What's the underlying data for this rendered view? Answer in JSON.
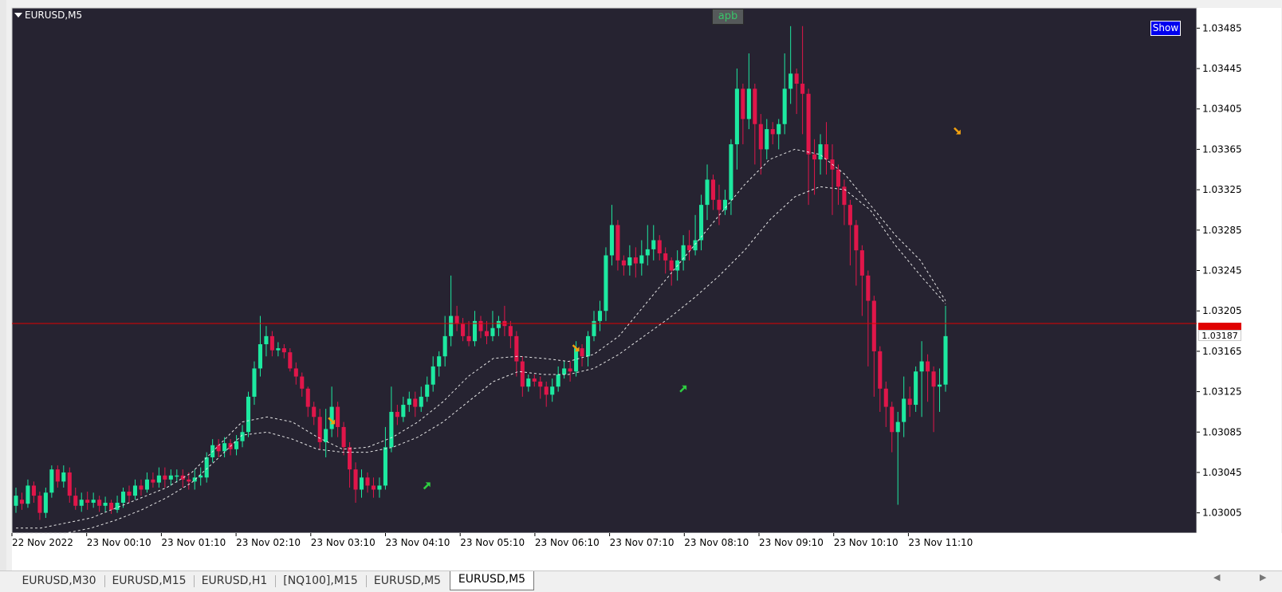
{
  "chart_label": "EURUSD,M5",
  "indicator_badge": "apb",
  "show_button": "Show",
  "current_price": "1.03187",
  "colors": {
    "background": "#262331",
    "bull": "#1de9a0",
    "bear": "#e0164a",
    "price_line": "#e00000",
    "envelope": "#e6e6e6",
    "sell_arrow": "#f0a010",
    "buy_arrow": "#2ecc40"
  },
  "tabs": [
    {
      "label": "EURUSD,M30",
      "active": false
    },
    {
      "label": "EURUSD,M15",
      "active": false
    },
    {
      "label": "EURUSD,H1",
      "active": false
    },
    {
      "label": "[NQ100],M15",
      "active": false
    },
    {
      "label": "EURUSD,M5",
      "active": false
    },
    {
      "label": "EURUSD,M5",
      "active": true
    }
  ],
  "chart_data": {
    "type": "candlestick",
    "symbol": "EURUSD",
    "timeframe": "M5",
    "ylim": [
      1.02985,
      1.03505
    ],
    "y_ticks": [
      "1.03485",
      "1.03445",
      "1.03405",
      "1.03365",
      "1.03325",
      "1.03285",
      "1.03245",
      "1.03205",
      "1.03165",
      "1.03125",
      "1.03085",
      "1.03045",
      "1.03005"
    ],
    "x_ticks": [
      "22 Nov 2022",
      "23 Nov 00:10",
      "23 Nov 01:10",
      "23 Nov 02:10",
      "23 Nov 03:10",
      "23 Nov 04:10",
      "23 Nov 05:10",
      "23 Nov 06:10",
      "23 Nov 07:10",
      "23 Nov 08:10",
      "23 Nov 09:10",
      "23 Nov 10:10",
      "23 Nov 11:10"
    ],
    "current_price": 1.03187,
    "candles": [
      [
        1.03012,
        1.03022,
        1.0303,
        1.03005
      ],
      [
        1.03018,
        1.03014,
        1.03025,
        1.03008
      ],
      [
        1.03014,
        1.03032,
        1.03038,
        1.0301
      ],
      [
        1.03032,
        1.03022,
        1.03036,
        1.03015
      ],
      [
        1.03022,
        1.03005,
        1.03026,
        1.02998
      ],
      [
        1.03005,
        1.03025,
        1.0303,
        1.03
      ],
      [
        1.03025,
        1.03048,
        1.03052,
        1.0302
      ],
      [
        1.03048,
        1.03036,
        1.03052,
        1.0303
      ],
      [
        1.03036,
        1.03045,
        1.03052,
        1.0303
      ],
      [
        1.03045,
        1.03022,
        1.0305,
        1.03015
      ],
      [
        1.03022,
        1.03012,
        1.0303,
        1.03008
      ],
      [
        1.03012,
        1.03018,
        1.03025,
        1.03006
      ],
      [
        1.03018,
        1.03015,
        1.03026,
        1.03008
      ],
      [
        1.03015,
        1.03018,
        1.03025,
        1.0301
      ],
      [
        1.03018,
        1.03012,
        1.03022,
        1.03006
      ],
      [
        1.03012,
        1.03015,
        1.03021,
        1.03006
      ],
      [
        1.03015,
        1.03008,
        1.03018,
        1.03004
      ],
      [
        1.03008,
        1.03015,
        1.03022,
        1.03005
      ],
      [
        1.03015,
        1.03026,
        1.0303,
        1.0301
      ],
      [
        1.03026,
        1.03022,
        1.03032,
        1.03015
      ],
      [
        1.03022,
        1.03032,
        1.03038,
        1.03018
      ],
      [
        1.03032,
        1.03028,
        1.03038,
        1.03022
      ],
      [
        1.03028,
        1.03038,
        1.03045,
        1.03025
      ],
      [
        1.03038,
        1.03035,
        1.03045,
        1.0303
      ],
      [
        1.03035,
        1.03042,
        1.0305,
        1.0303
      ],
      [
        1.03042,
        1.03038,
        1.0305,
        1.0303
      ],
      [
        1.03038,
        1.03042,
        1.03048,
        1.03032
      ],
      [
        1.03042,
        1.03042,
        1.03048,
        1.03035
      ],
      [
        1.03042,
        1.03038,
        1.03048,
        1.0303
      ],
      [
        1.03038,
        1.03036,
        1.03045,
        1.03028
      ],
      [
        1.03036,
        1.0304,
        1.03048,
        1.03028
      ],
      [
        1.0304,
        1.03042,
        1.0305,
        1.03032
      ],
      [
        1.0304,
        1.0306,
        1.03065,
        1.03035
      ],
      [
        1.0306,
        1.03072,
        1.03078,
        1.03055
      ],
      [
        1.03072,
        1.03066,
        1.03078,
        1.0306
      ],
      [
        1.03066,
        1.03074,
        1.0308,
        1.0306
      ],
      [
        1.03074,
        1.03068,
        1.03078,
        1.03062
      ],
      [
        1.03068,
        1.03076,
        1.03082,
        1.03062
      ],
      [
        1.03076,
        1.03085,
        1.03092,
        1.0307
      ],
      [
        1.03085,
        1.0312,
        1.03125,
        1.0308
      ],
      [
        1.0312,
        1.03148,
        1.03155,
        1.03112
      ],
      [
        1.03148,
        1.03172,
        1.032,
        1.0314
      ],
      [
        1.03172,
        1.0318,
        1.0319,
        1.0316
      ],
      [
        1.0318,
        1.03166,
        1.03185,
        1.0316
      ],
      [
        1.03166,
        1.03168,
        1.03174,
        1.0316
      ],
      [
        1.03168,
        1.03164,
        1.03172,
        1.03158
      ],
      [
        1.03164,
        1.03148,
        1.03168,
        1.03145
      ],
      [
        1.03148,
        1.0314,
        1.03154,
        1.03132
      ],
      [
        1.0314,
        1.03128,
        1.03144,
        1.0312
      ],
      [
        1.03128,
        1.0311,
        1.0313,
        1.031
      ],
      [
        1.0311,
        1.031,
        1.03115,
        1.03092
      ],
      [
        1.031,
        1.03075,
        1.03108,
        1.03068
      ],
      [
        1.03075,
        1.03088,
        1.03108,
        1.0306
      ],
      [
        1.03088,
        1.0311,
        1.0313,
        1.0308
      ],
      [
        1.0311,
        1.0309,
        1.03115,
        1.0308
      ],
      [
        1.0309,
        1.0307,
        1.03095,
        1.03062
      ],
      [
        1.0307,
        1.03048,
        1.03075,
        1.0303
      ],
      [
        1.03048,
        1.03028,
        1.03055,
        1.03015
      ],
      [
        1.03028,
        1.0304,
        1.03048,
        1.0302
      ],
      [
        1.0304,
        1.03032,
        1.03045,
        1.03025
      ],
      [
        1.03032,
        1.03028,
        1.0304,
        1.0302
      ],
      [
        1.03028,
        1.03032,
        1.0304,
        1.0302
      ],
      [
        1.03032,
        1.0307,
        1.0309,
        1.03028
      ],
      [
        1.0307,
        1.03105,
        1.0313,
        1.03065
      ],
      [
        1.03105,
        1.031,
        1.03112,
        1.03092
      ],
      [
        1.031,
        1.03112,
        1.0312,
        1.03095
      ],
      [
        1.03112,
        1.03118,
        1.03125,
        1.03105
      ],
      [
        1.03118,
        1.0311,
        1.03125,
        1.031
      ],
      [
        1.0311,
        1.0312,
        1.0313,
        1.03105
      ],
      [
        1.0312,
        1.03132,
        1.0314,
        1.03115
      ],
      [
        1.03132,
        1.0315,
        1.0316,
        1.03125
      ],
      [
        1.0315,
        1.0316,
        1.03165,
        1.0314
      ],
      [
        1.0316,
        1.0318,
        1.032,
        1.0315
      ],
      [
        1.0318,
        1.032,
        1.0324,
        1.0317
      ],
      [
        1.032,
        1.03192,
        1.0321,
        1.03185
      ],
      [
        1.03192,
        1.0318,
        1.03198,
        1.03175
      ],
      [
        1.0318,
        1.03175,
        1.03195,
        1.0317
      ],
      [
        1.03175,
        1.03195,
        1.03205,
        1.0317
      ],
      [
        1.03195,
        1.03185,
        1.032,
        1.03178
      ],
      [
        1.03185,
        1.0318,
        1.03195,
        1.03172
      ],
      [
        1.0318,
        1.03188,
        1.03205,
        1.03175
      ],
      [
        1.03188,
        1.03195,
        1.032,
        1.0318
      ],
      [
        1.03195,
        1.0319,
        1.0321,
        1.0318
      ],
      [
        1.0319,
        1.0318,
        1.03195,
        1.03168
      ],
      [
        1.0318,
        1.03155,
        1.03185,
        1.0314
      ],
      [
        1.03155,
        1.0313,
        1.0316,
        1.0312
      ],
      [
        1.0313,
        1.03138,
        1.03142,
        1.03125
      ],
      [
        1.03138,
        1.03135,
        1.03142,
        1.0313
      ],
      [
        1.03135,
        1.0313,
        1.0314,
        1.03118
      ],
      [
        1.0313,
        1.03122,
        1.03135,
        1.0311
      ],
      [
        1.03122,
        1.0313,
        1.03138,
        1.03115
      ],
      [
        1.0313,
        1.03142,
        1.0315,
        1.03125
      ],
      [
        1.03142,
        1.03148,
        1.03155,
        1.03138
      ],
      [
        1.03148,
        1.03145,
        1.03155,
        1.03135
      ],
      [
        1.03145,
        1.03168,
        1.03175,
        1.0314
      ],
      [
        1.03168,
        1.0316,
        1.03172,
        1.0315
      ],
      [
        1.0316,
        1.0318,
        1.03185,
        1.0315
      ],
      [
        1.0318,
        1.03195,
        1.03205,
        1.03175
      ],
      [
        1.03195,
        1.03205,
        1.03215,
        1.03185
      ],
      [
        1.03205,
        1.0326,
        1.03268,
        1.03195
      ],
      [
        1.0326,
        1.0329,
        1.0331,
        1.0325
      ],
      [
        1.0329,
        1.03255,
        1.03295,
        1.03245
      ],
      [
        1.03255,
        1.0325,
        1.0326,
        1.0324
      ],
      [
        1.0325,
        1.03258,
        1.0327,
        1.0324
      ],
      [
        1.03258,
        1.03252,
        1.03268,
        1.03238
      ],
      [
        1.03252,
        1.0326,
        1.03275,
        1.0324
      ],
      [
        1.0326,
        1.03266,
        1.0329,
        1.0325
      ],
      [
        1.03266,
        1.03275,
        1.0329,
        1.03255
      ],
      [
        1.03275,
        1.03262,
        1.0328,
        1.03255
      ],
      [
        1.03262,
        1.03255,
        1.03268,
        1.03242
      ],
      [
        1.03255,
        1.03245,
        1.03258,
        1.0323
      ],
      [
        1.03245,
        1.03255,
        1.03265,
        1.03235
      ],
      [
        1.03255,
        1.0327,
        1.0328,
        1.03245
      ],
      [
        1.0327,
        1.03265,
        1.03285,
        1.03255
      ],
      [
        1.03265,
        1.03275,
        1.033,
        1.0326
      ],
      [
        1.03275,
        1.0331,
        1.0332,
        1.03265
      ],
      [
        1.0331,
        1.03335,
        1.0335,
        1.03295
      ],
      [
        1.03335,
        1.03315,
        1.0334,
        1.03305
      ],
      [
        1.03315,
        1.03305,
        1.0333,
        1.0329
      ],
      [
        1.03305,
        1.03315,
        1.03325,
        1.033
      ],
      [
        1.03315,
        1.0337,
        1.03375,
        1.033
      ],
      [
        1.0337,
        1.03425,
        1.03445,
        1.03345
      ],
      [
        1.03425,
        1.03395,
        1.0343,
        1.0337
      ],
      [
        1.03395,
        1.03425,
        1.0346,
        1.03385
      ],
      [
        1.03425,
        1.0339,
        1.0343,
        1.0335
      ],
      [
        1.0339,
        1.03365,
        1.034,
        1.0334
      ],
      [
        1.03365,
        1.03385,
        1.03395,
        1.03355
      ],
      [
        1.03385,
        1.0338,
        1.03392,
        1.0337
      ],
      [
        1.0338,
        1.0339,
        1.03395,
        1.03365
      ],
      [
        1.0339,
        1.03425,
        1.0346,
        1.0338
      ],
      [
        1.03425,
        1.0344,
        1.03487,
        1.0341
      ],
      [
        1.0344,
        1.0343,
        1.03445,
        1.034
      ],
      [
        1.0343,
        1.0342,
        1.03487,
        1.0338
      ],
      [
        1.0342,
        1.0336,
        1.03425,
        1.0331
      ],
      [
        1.0336,
        1.03355,
        1.03375,
        1.0332
      ],
      [
        1.03355,
        1.0337,
        1.0338,
        1.0334
      ],
      [
        1.0337,
        1.03355,
        1.03392,
        1.0334
      ],
      [
        1.03355,
        1.03345,
        1.0337,
        1.033
      ],
      [
        1.03345,
        1.03328,
        1.0335,
        1.0331
      ],
      [
        1.03328,
        1.0331,
        1.03335,
        1.0329
      ],
      [
        1.0331,
        1.0329,
        1.03315,
        1.0325
      ],
      [
        1.0329,
        1.03265,
        1.03295,
        1.0323
      ],
      [
        1.03265,
        1.0324,
        1.0327,
        1.032
      ],
      [
        1.0324,
        1.03215,
        1.03245,
        1.0315
      ],
      [
        1.03215,
        1.03165,
        1.0322,
        1.0312
      ],
      [
        1.03165,
        1.03128,
        1.0317,
        1.03105
      ],
      [
        1.03128,
        1.0311,
        1.03135,
        1.0309
      ],
      [
        1.0311,
        1.03085,
        1.03115,
        1.03065
      ],
      [
        1.03085,
        1.03095,
        1.03105,
        1.03013
      ],
      [
        1.03095,
        1.03118,
        1.0314,
        1.0308
      ],
      [
        1.03118,
        1.03112,
        1.0313,
        1.031
      ],
      [
        1.03112,
        1.03145,
        1.0315,
        1.03105
      ],
      [
        1.03145,
        1.03155,
        1.03175,
        1.031
      ],
      [
        1.03155,
        1.03145,
        1.03162,
        1.03115
      ],
      [
        1.03145,
        1.0313,
        1.0315,
        1.03085
      ],
      [
        1.0313,
        1.03132,
        1.03148,
        1.03105
      ],
      [
        1.03132,
        1.0318,
        1.0321,
        1.03125
      ]
    ],
    "envelope": {
      "upper": [
        1.0299,
        1.0299,
        1.02995,
        1.03,
        1.0301,
        1.0302,
        1.0303,
        1.03045,
        1.0307,
        1.03095,
        1.031,
        1.03095,
        1.0308,
        1.03068,
        1.0307,
        1.0308,
        1.03095,
        1.03115,
        1.0314,
        1.03158,
        1.0316,
        1.03158,
        1.03155,
        1.03162,
        1.0318,
        1.0321,
        1.0324,
        1.0327,
        1.033,
        1.0333,
        1.03355,
        1.03365,
        1.0336,
        1.0334,
        1.0331,
        1.0328,
        1.03255,
        1.03215
      ],
      "lower": [
        1.02985,
        1.02985,
        1.02985,
        1.0299,
        1.02998,
        1.03008,
        1.0302,
        1.03035,
        1.03058,
        1.03082,
        1.03085,
        1.03078,
        1.03068,
        1.03065,
        1.03065,
        1.0307,
        1.0308,
        1.03095,
        1.03115,
        1.03135,
        1.03145,
        1.03142,
        1.03142,
        1.03148,
        1.03162,
        1.0318,
        1.03198,
        1.03218,
        1.0324,
        1.03265,
        1.03295,
        1.03318,
        1.03328,
        1.03325,
        1.03305,
        1.0327,
        1.0324,
        1.03212
      ]
    },
    "signals": [
      {
        "type": "sell",
        "price": 1.03096
      },
      {
        "type": "buy",
        "price": 1.03032
      },
      {
        "type": "sell",
        "price": 1.03168
      },
      {
        "type": "buy",
        "price": 1.03128
      },
      {
        "type": "sell",
        "price": 1.03383
      }
    ]
  }
}
